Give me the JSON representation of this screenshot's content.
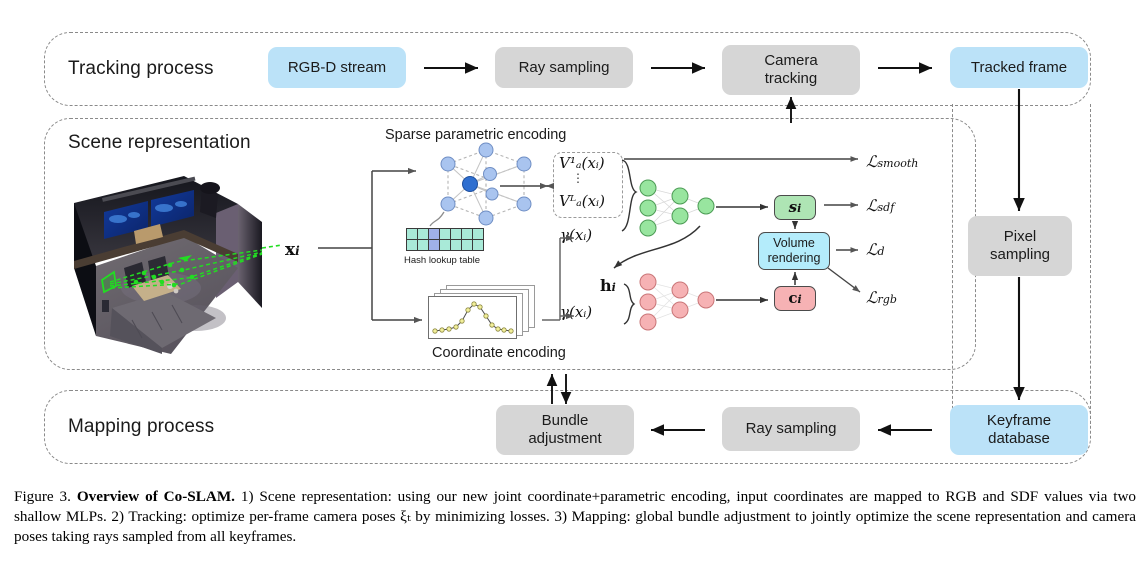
{
  "figure": {
    "number": "Figure 3.",
    "title": "Overview of Co-SLAM.",
    "caption_rest": " 1) Scene representation: using our new joint coordinate+parametric encoding, input coordinates are mapped to RGB and SDF values via two shallow MLPs.  2) Tracking: optimize per-frame camera poses ξₜ by minimizing losses.  3) Mapping: global bundle adjustment to jointly optimize the scene representation and camera poses taking rays sampled from all keyframes."
  },
  "panels": {
    "tracking": {
      "title": "Tracking process"
    },
    "scene": {
      "title": "Scene representation"
    },
    "mapping": {
      "title": "Mapping process"
    }
  },
  "tracking_row": {
    "nodes": [
      {
        "label": "RGB-D stream",
        "style": "blue"
      },
      {
        "label": "Ray sampling",
        "style": "gray"
      },
      {
        "label": "Camera\ntracking",
        "style": "gray"
      },
      {
        "label": "Tracked frame",
        "style": "blue"
      }
    ]
  },
  "mapping_row": {
    "nodes": [
      {
        "label": "Bundle\nadjustment",
        "style": "gray"
      },
      {
        "label": "Ray sampling",
        "style": "gray"
      },
      {
        "label": "Keyframe\ndatabase",
        "style": "blue"
      }
    ]
  },
  "right_column": {
    "nodes": [
      {
        "label": "Pixel\nsampling",
        "style": "gray"
      }
    ]
  },
  "scene": {
    "point_label": "x_i",
    "encoding_titles": {
      "sparse": "Sparse parametric encoding",
      "coordinate": "Coordinate encoding"
    },
    "hash_table_label": "Hash lookup table",
    "feature_box": {
      "top": "V¹ₐ(xᵢ)",
      "bottom": "Vᴸₐ(xᵢ)"
    },
    "gamma_top": "γ(xᵢ)",
    "gamma_bottom": "γ(xᵢ)",
    "hidden_label": "h_i",
    "outputs": {
      "sdf": "s_i",
      "color": "c_i",
      "volume_rendering": "Volume\nrendering"
    },
    "losses": [
      "L_smooth",
      "L_sdf",
      "L_d",
      "L_rgb"
    ]
  },
  "colors": {
    "blue_box": "#bbe2f8",
    "gray_box": "#d6d6d6",
    "green_node": "#98e59f",
    "red_node": "#f6b2b4",
    "cyan_box": "#b4ecfb",
    "hash_cell": "#a9ead8",
    "hash_cell_active": "#9fb1e8",
    "lattice_node": "#a9c4ef",
    "lattice_center": "#2f6fd0",
    "ray_green": "#22dd22",
    "dash_border": "#8a8a8a"
  }
}
